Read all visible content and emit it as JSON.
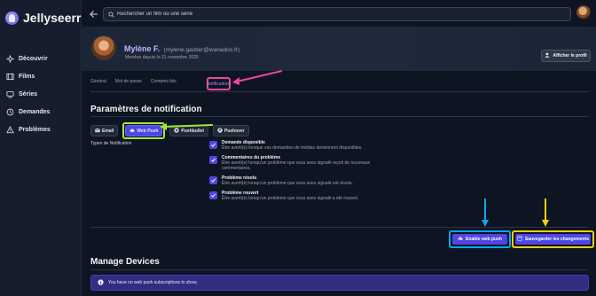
{
  "app": {
    "name": "Jellyseerr"
  },
  "sidebar": {
    "items": [
      {
        "label": "Découvrir",
        "icon": "sparkles-icon"
      },
      {
        "label": "Films",
        "icon": "film-icon"
      },
      {
        "label": "Séries",
        "icon": "tv-icon"
      },
      {
        "label": "Demandes",
        "icon": "clock-icon"
      },
      {
        "label": "Problèmes",
        "icon": "warning-icon"
      }
    ]
  },
  "search": {
    "placeholder": "Rechercher un film ou une série"
  },
  "profile": {
    "name": "Mylène F.",
    "email": "(mylene.gautier@wanadoo.fr)",
    "member_since": "Membre depuis le 21 novembre 2025",
    "view_profile_label": "Afficher le profil"
  },
  "tabs": [
    {
      "label": "Général"
    },
    {
      "label": "Mot de passe"
    },
    {
      "label": "Comptes liés"
    },
    {
      "label": "Notifications",
      "active": true
    }
  ],
  "notifications": {
    "title": "Paramètres de notification",
    "agents": [
      {
        "label": "Email",
        "icon": "email-icon"
      },
      {
        "label": "Web Push",
        "icon": "cloud-icon",
        "active": true
      },
      {
        "label": "Pushbullet",
        "icon": "pushbullet-icon"
      },
      {
        "label": "Pushover",
        "icon": "pushover-icon"
      }
    ],
    "types_label": "Types de Notification",
    "types": [
      {
        "title": "Demande disponible",
        "desc": "Être averti(e) lorsque vos demandes de médias deviennent disponibles.",
        "checked": true
      },
      {
        "title": "Commentaires du problème",
        "desc": "Être averti(e) lorsqu'un problème que vous avez signalé reçoit de nouveaux commentaires.",
        "checked": true
      },
      {
        "title": "Problème résolu",
        "desc": "Être averti(e) lorsqu'un problème que vous avez signalé est résolu.",
        "checked": true
      },
      {
        "title": "Problème rouvert",
        "desc": "Être averti(e) lorsqu'un problème que vous avez signalé a été rouvert.",
        "checked": true
      }
    ],
    "enable_label": "Enable web push",
    "save_label": "Sauvegarder les changements"
  },
  "devices": {
    "title": "Manage Devices",
    "empty_message": "You have no web push subscriptions to show."
  },
  "colors": {
    "accent": "#4f46e5",
    "annotation_pink": "#ec4899",
    "annotation_green": "#a3e635",
    "annotation_blue": "#0ea5e9",
    "annotation_yellow": "#facc15"
  }
}
